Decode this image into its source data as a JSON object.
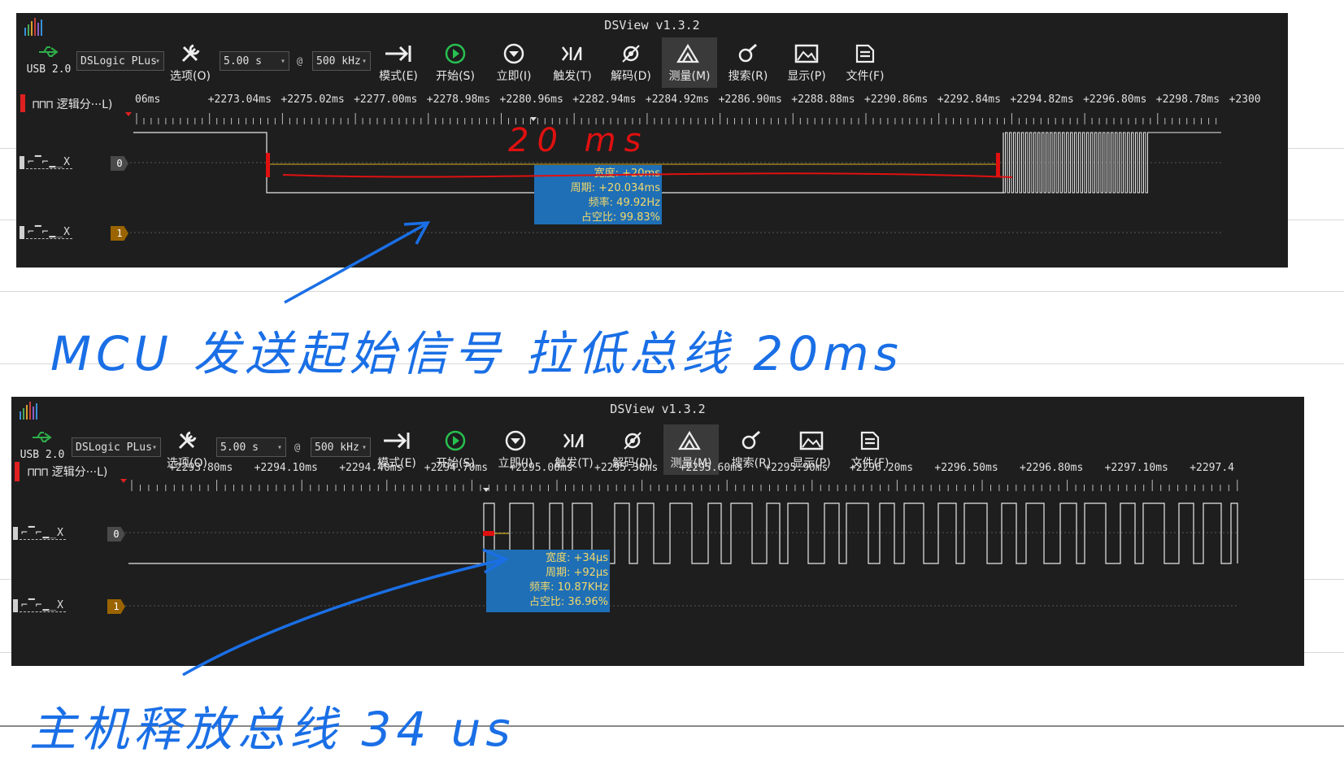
{
  "app_title": "DSView v1.3.2",
  "usb_label": "USB 2.0",
  "device": "DSLogic PLus",
  "toolbar": {
    "options": "选项(O)",
    "mode": "模式(E)",
    "start": "开始(S)",
    "instant": "立即(I)",
    "trigger": "触发(T)",
    "decode": "解码(D)",
    "measure": "测量(M)",
    "search": "搜索(R)",
    "display": "显示(P)",
    "file": "文件(F)"
  },
  "group_label": "逻辑分···L)",
  "channels": [
    {
      "wave": "⌐▔⌐▁_X",
      "index": "0"
    },
    {
      "wave": "⌐▔⌐▁_X",
      "index": "1"
    }
  ],
  "shot1": {
    "duration": "5.00 s",
    "at": "@",
    "rate": "500 kHz",
    "ticks": [
      "06ms",
      "+2273.04ms",
      "+2275.02ms",
      "+2277.00ms",
      "+2278.98ms",
      "+2280.96ms",
      "+2282.94ms",
      "+2284.92ms",
      "+2286.90ms",
      "+2288.88ms",
      "+2290.86ms",
      "+2292.84ms",
      "+2294.82ms",
      "+2296.80ms",
      "+2298.78ms",
      "+2300"
    ],
    "measurement": {
      "width": "宽度: +20ms",
      "period": "周期: +20.034ms",
      "freq": "频率: 49.92Hz",
      "duty": "占空比: 99.83%"
    },
    "annotation": "20 ms"
  },
  "note1": "MCU 发送起始信号  拉低总线 20ms",
  "shot2": {
    "duration": "5.00 s",
    "at": "@",
    "rate": "500 kHz",
    "ticks": [
      "+2293.80ms",
      "+2294.10ms",
      "+2294.40ms",
      "+2294.70ms",
      "+2295.00ms",
      "+2295.30ms",
      "+2295.60ms",
      "+2295.90ms",
      "+2296.20ms",
      "+2296.50ms",
      "+2296.80ms",
      "+2297.10ms",
      "+2297.4"
    ],
    "measurement": {
      "width": "宽度: +34μs",
      "period": "周期: +92μs",
      "freq": "频率: 10.87KHz",
      "duty": "占空比: 36.96%"
    }
  },
  "note2": "主机释放总线  34 us",
  "colors": {
    "bg": "#1e1e1e",
    "measure_box": "#1f6fb6",
    "measure_text": "#f2d86a",
    "ink_blue": "#1a6fe6",
    "ink_red": "#e01010",
    "ch1_badge": "#9a6400"
  }
}
